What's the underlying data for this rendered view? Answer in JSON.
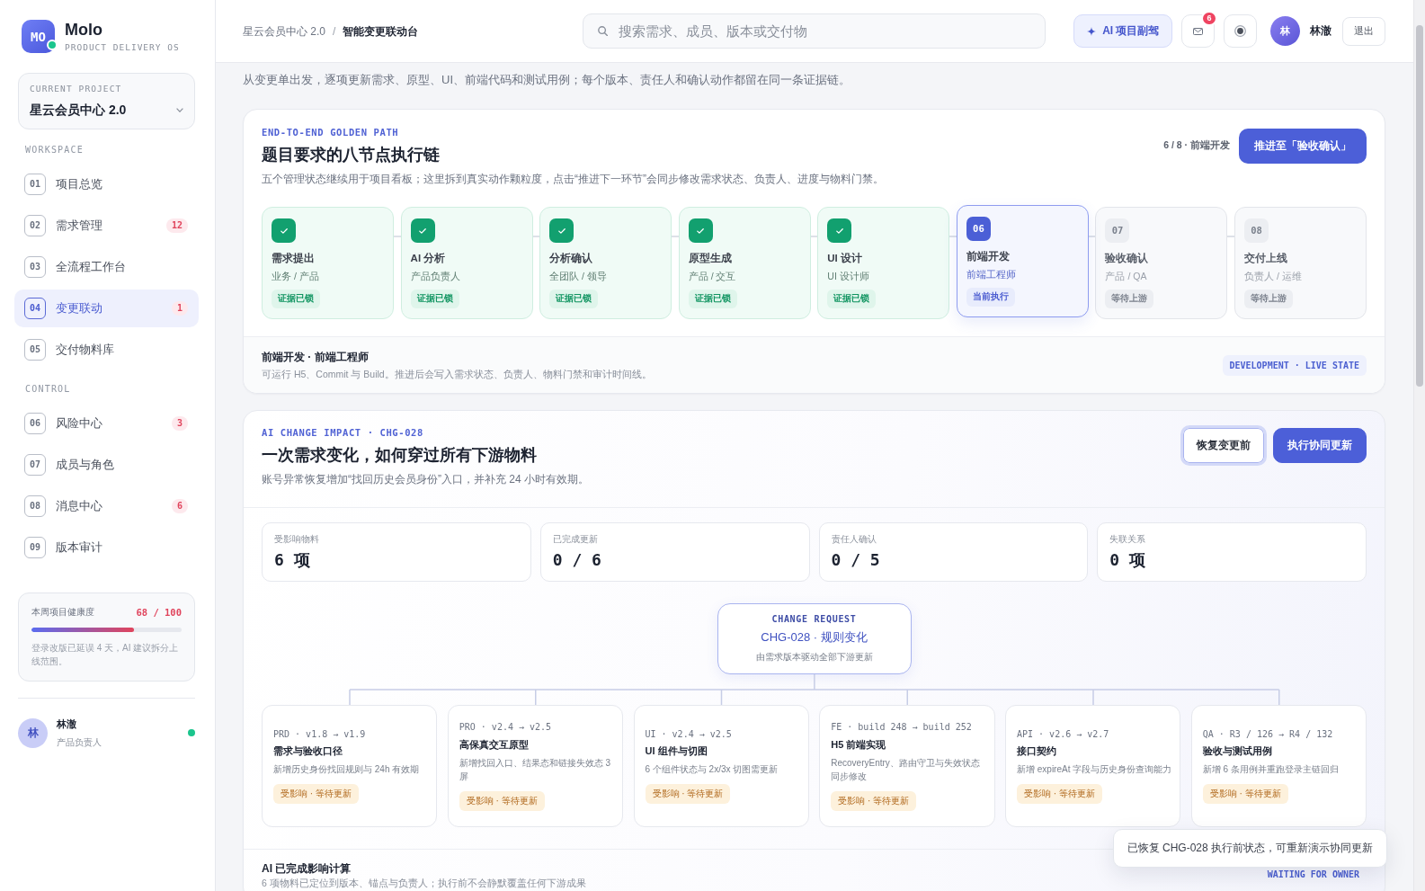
{
  "sidebar": {
    "logo": {
      "mark": "MO",
      "name": "Molo",
      "tagline": "PRODUCT DELIVERY OS",
      "online": true
    },
    "project": {
      "label": "CURRENT PROJECT",
      "name": "星云会员中心 2.0"
    },
    "sections": [
      {
        "title": "WORKSPACE",
        "items": [
          {
            "number": "01",
            "label": "项目总览",
            "selected": false
          },
          {
            "number": "02",
            "label": "需求管理",
            "badge": "12",
            "selected": false
          },
          {
            "number": "03",
            "label": "全流程工作台",
            "selected": false
          },
          {
            "number": "04",
            "label": "变更联动",
            "badge": "1",
            "selected": true
          },
          {
            "number": "05",
            "label": "交付物料库",
            "selected": false
          }
        ]
      },
      {
        "title": "CONTROL",
        "items": [
          {
            "number": "06",
            "label": "风险中心",
            "badge": "3",
            "selected": false
          },
          {
            "number": "07",
            "label": "成员与角色",
            "selected": false
          },
          {
            "number": "08",
            "label": "消息中心",
            "badge": "6",
            "selected": false
          },
          {
            "number": "09",
            "label": "版本审计",
            "selected": false
          }
        ]
      }
    ],
    "health": {
      "title": "本周项目健康度",
      "score": "68 / 100",
      "level": 0.68,
      "note": "登录改版已延误 4 天，AI 建议拆分上线范围。"
    },
    "user": {
      "avatar": "林",
      "name": "林澈",
      "role": "产品负责人",
      "online": true
    }
  },
  "header": {
    "breadcrumb": [
      {
        "label": "星云会员中心 2.0",
        "current": false
      },
      {
        "label": "智能变更联动台",
        "current": true
      }
    ],
    "separator": "/",
    "search": {
      "placeholder": "搜索需求、成员、版本或交付物"
    },
    "copilot_button": "AI 项目副驾",
    "mail_badge": "6",
    "user": {
      "avatar": "林",
      "name": "林澈"
    },
    "logout_button": "退出"
  },
  "intro": "从变更单出发，逐项更新需求、原型、UI、前端代码和测试用例；每个版本、责任人和确认动作都留在同一条证据链。",
  "golden_path": {
    "eyebrow": "END-TO-END GOLDEN PATH",
    "title": "题目要求的八节点执行链",
    "description": "五个管理状态继续用于项目看板；这里拆到真实动作颗粒度，点击“推进下一环节”会同步修改需求状态、负责人、进度与物料门禁。",
    "progress": "6 / 8 · 前端开发",
    "advance_button": "推进至「验收确认」",
    "steps": [
      {
        "kind": "done",
        "name": "需求提出",
        "owner": "业务 / 产品",
        "status": "证据已锁"
      },
      {
        "kind": "done",
        "name": "AI 分析",
        "owner": "产品负责人",
        "status": "证据已锁"
      },
      {
        "kind": "done",
        "name": "分析确认",
        "owner": "全团队 / 领导",
        "status": "证据已锁"
      },
      {
        "kind": "done",
        "name": "原型生成",
        "owner": "产品 / 交互",
        "status": "证据已锁"
      },
      {
        "kind": "done",
        "name": "UI 设计",
        "owner": "UI 设计师",
        "status": "证据已锁"
      },
      {
        "kind": "current",
        "number": "06",
        "name": "前端开发",
        "owner": "前端工程师",
        "status": "当前执行"
      },
      {
        "kind": "pending",
        "number": "07",
        "name": "验收确认",
        "owner": "产品 / QA",
        "status": "等待上游"
      },
      {
        "kind": "pending",
        "number": "08",
        "name": "交付上线",
        "owner": "负责人 / 运维",
        "status": "等待上游"
      }
    ],
    "footer": {
      "title": "前端开发 · 前端工程师",
      "text": "可运行 H5、Commit 与 Build。推进后会写入需求状态、负责人、物料门禁和审计时间线。",
      "tag": "DEVELOPMENT · LIVE STATE"
    }
  },
  "change_impact": {
    "eyebrow": "AI CHANGE IMPACT · CHG-028",
    "title": "一次需求变化，如何穿过所有下游物料",
    "description": "账号异常恢复增加“找回历史会员身份”入口，并补充 24 小时有效期。",
    "buttons": [
      {
        "label": "恢复变更前",
        "kind": "secondary",
        "focused": true
      },
      {
        "label": "执行协同更新",
        "kind": "primary",
        "focused": false
      }
    ],
    "stats": [
      {
        "label": "受影响物料",
        "value": "6 项"
      },
      {
        "label": "已完成更新",
        "value": "0 / 6"
      },
      {
        "label": "责任人确认",
        "value": "0 / 5"
      },
      {
        "label": "失联关系",
        "value": "0 项"
      }
    ],
    "request": {
      "eyebrow": "CHANGE REQUEST",
      "title": "CHG-028 · 规则变化",
      "subtitle": "由需求版本驱动全部下游更新"
    },
    "artifacts": [
      {
        "version": "PRD · v1.8 → v1.9",
        "title": "需求与验收口径",
        "description": "新增历史身份找回规则与 24h 有效期",
        "status": "受影响 · 等待更新"
      },
      {
        "version": "PRO · v2.4 → v2.5",
        "title": "高保真交互原型",
        "description": "新增找回入口、结果态和链接失效态 3 屏",
        "status": "受影响 · 等待更新"
      },
      {
        "version": "UI · v2.4 → v2.5",
        "title": "UI 组件与切图",
        "description": "6 个组件状态与 2x/3x 切图需更新",
        "status": "受影响 · 等待更新"
      },
      {
        "version": "FE · build 248 → build 252",
        "title": "H5 前端实现",
        "description": "RecoveryEntry、路由守卫与失效状态同步修改",
        "status": "受影响 · 等待更新"
      },
      {
        "version": "API · v2.6 → v2.7",
        "title": "接口契约",
        "description": "新增 expireAt 字段与历史身份查询能力",
        "status": "受影响 · 等待更新"
      },
      {
        "version": "QA · R3 / 126 → R4 / 132",
        "title": "验收与测试用例",
        "description": "新增 6 条用例并重跑登录主链回归",
        "status": "受影响 · 等待更新"
      }
    ],
    "footer": {
      "title": "AI 已完成影响计算",
      "text": "6 项物料已定位到版本、锚点与负责人；执行前不会静默覆盖任何下游成果",
      "tag": "WAITING FOR OWNER"
    }
  },
  "toast": {
    "message": "已恢复 CHG-028 执行前状态，可重新演示协同更新"
  }
}
